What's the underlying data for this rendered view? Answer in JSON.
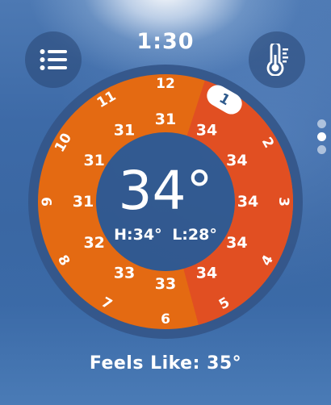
{
  "clock": {
    "time": "1:30",
    "current_hour": "1"
  },
  "buttons": {
    "menu": "list-icon",
    "units": "thermometer-icon"
  },
  "pager": {
    "count": 3,
    "active_index": 1
  },
  "dial": {
    "hour_labels": [
      "12",
      "1",
      "2",
      "3",
      "4",
      "5",
      "6",
      "7",
      "8",
      "9",
      "10",
      "11"
    ],
    "hourly_temps": [
      "31",
      "34",
      "34",
      "34",
      "34",
      "34",
      "33",
      "33",
      "32",
      "31",
      "31",
      "31"
    ],
    "colors": {
      "cooler": "#e46a12",
      "hotter": "#e14f22",
      "ring_track": "#345689",
      "pill": "#ffffff",
      "pill_text": "#2e5a8c"
    }
  },
  "current": {
    "temp": "34°",
    "high": "H:34°",
    "low": "L:28°"
  },
  "feels_like": "Feels Like: 35°"
}
